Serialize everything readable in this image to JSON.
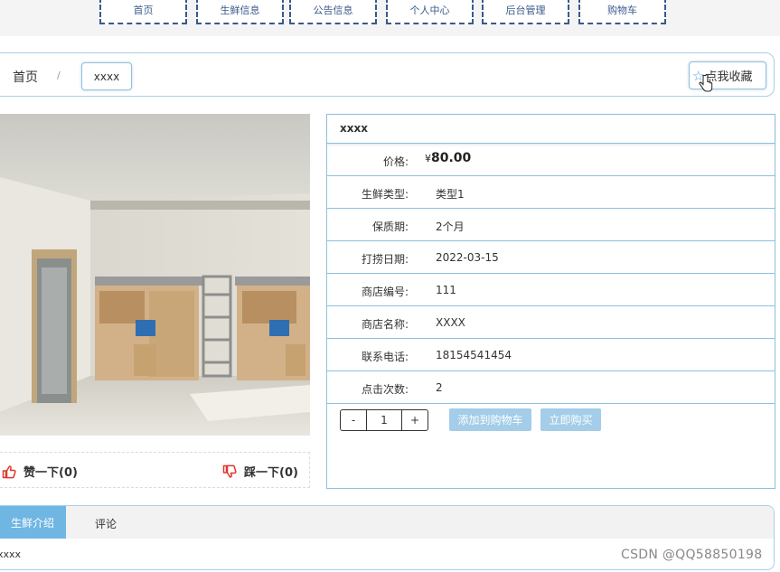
{
  "nav": {
    "items": [
      {
        "label": "首页"
      },
      {
        "label": "生鲜信息"
      },
      {
        "label": "公告信息"
      },
      {
        "label": "个人中心"
      },
      {
        "label": "后台管理"
      },
      {
        "label": "购物车"
      }
    ]
  },
  "breadcrumb": {
    "home": "首页",
    "separator": "/",
    "current": "xxxx"
  },
  "favorite": {
    "label": "点我收藏",
    "icon": "star-icon"
  },
  "votes": {
    "like_label": "赞一下(0)",
    "dislike_label": "踩一下(0)",
    "like_color": "#e0362b"
  },
  "product": {
    "title": "xxxx",
    "price_symbol": "¥",
    "price": "80.00",
    "fields": [
      {
        "label": "价格:"
      },
      {
        "label": "生鲜类型:",
        "value": "类型1"
      },
      {
        "label": "保质期:",
        "value": "2个月"
      },
      {
        "label": "打捞日期:",
        "value": "2022-03-15"
      },
      {
        "label": "商店编号:",
        "value": "111"
      },
      {
        "label": "商店名称:",
        "value": "XXXX"
      },
      {
        "label": "联系电话:",
        "value": "18154541454"
      },
      {
        "label": "点击次数:",
        "value": "2"
      }
    ]
  },
  "cart": {
    "minus": "-",
    "quantity": "1",
    "plus": "+",
    "add_to_cart": "添加到购物车",
    "buy_now": "立即购买"
  },
  "tabs": {
    "items": [
      {
        "label": "生鲜介绍"
      },
      {
        "label": "评论"
      }
    ],
    "content": "xxxx"
  },
  "watermark": "CSDN @QQ58850198",
  "colors": {
    "accent": "#6fb6e3",
    "border": "#8fc0dc",
    "nav_border": "#3a5a8a"
  }
}
